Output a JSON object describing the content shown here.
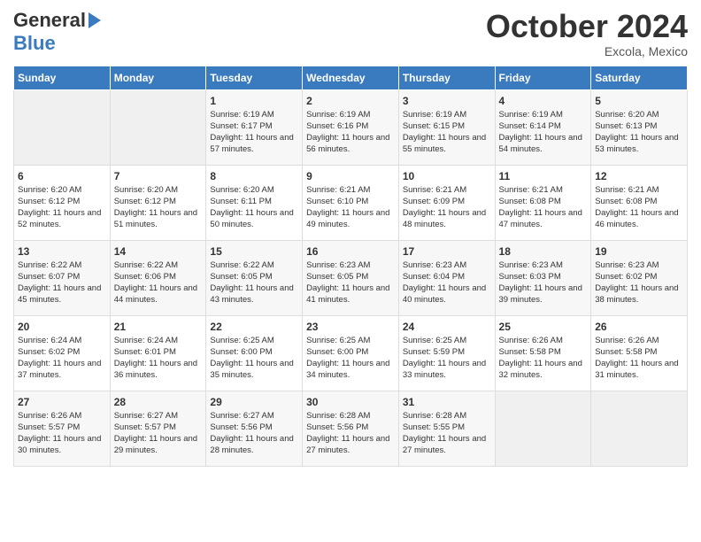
{
  "header": {
    "logo_line1": "General",
    "logo_line2": "Blue",
    "month": "October 2024",
    "location": "Excola, Mexico"
  },
  "weekdays": [
    "Sunday",
    "Monday",
    "Tuesday",
    "Wednesday",
    "Thursday",
    "Friday",
    "Saturday"
  ],
  "weeks": [
    [
      {
        "day": "",
        "info": ""
      },
      {
        "day": "",
        "info": ""
      },
      {
        "day": "1",
        "info": "Sunrise: 6:19 AM\nSunset: 6:17 PM\nDaylight: 11 hours and 57 minutes."
      },
      {
        "day": "2",
        "info": "Sunrise: 6:19 AM\nSunset: 6:16 PM\nDaylight: 11 hours and 56 minutes."
      },
      {
        "day": "3",
        "info": "Sunrise: 6:19 AM\nSunset: 6:15 PM\nDaylight: 11 hours and 55 minutes."
      },
      {
        "day": "4",
        "info": "Sunrise: 6:19 AM\nSunset: 6:14 PM\nDaylight: 11 hours and 54 minutes."
      },
      {
        "day": "5",
        "info": "Sunrise: 6:20 AM\nSunset: 6:13 PM\nDaylight: 11 hours and 53 minutes."
      }
    ],
    [
      {
        "day": "6",
        "info": "Sunrise: 6:20 AM\nSunset: 6:12 PM\nDaylight: 11 hours and 52 minutes."
      },
      {
        "day": "7",
        "info": "Sunrise: 6:20 AM\nSunset: 6:12 PM\nDaylight: 11 hours and 51 minutes."
      },
      {
        "day": "8",
        "info": "Sunrise: 6:20 AM\nSunset: 6:11 PM\nDaylight: 11 hours and 50 minutes."
      },
      {
        "day": "9",
        "info": "Sunrise: 6:21 AM\nSunset: 6:10 PM\nDaylight: 11 hours and 49 minutes."
      },
      {
        "day": "10",
        "info": "Sunrise: 6:21 AM\nSunset: 6:09 PM\nDaylight: 11 hours and 48 minutes."
      },
      {
        "day": "11",
        "info": "Sunrise: 6:21 AM\nSunset: 6:08 PM\nDaylight: 11 hours and 47 minutes."
      },
      {
        "day": "12",
        "info": "Sunrise: 6:21 AM\nSunset: 6:08 PM\nDaylight: 11 hours and 46 minutes."
      }
    ],
    [
      {
        "day": "13",
        "info": "Sunrise: 6:22 AM\nSunset: 6:07 PM\nDaylight: 11 hours and 45 minutes."
      },
      {
        "day": "14",
        "info": "Sunrise: 6:22 AM\nSunset: 6:06 PM\nDaylight: 11 hours and 44 minutes."
      },
      {
        "day": "15",
        "info": "Sunrise: 6:22 AM\nSunset: 6:05 PM\nDaylight: 11 hours and 43 minutes."
      },
      {
        "day": "16",
        "info": "Sunrise: 6:23 AM\nSunset: 6:05 PM\nDaylight: 11 hours and 41 minutes."
      },
      {
        "day": "17",
        "info": "Sunrise: 6:23 AM\nSunset: 6:04 PM\nDaylight: 11 hours and 40 minutes."
      },
      {
        "day": "18",
        "info": "Sunrise: 6:23 AM\nSunset: 6:03 PM\nDaylight: 11 hours and 39 minutes."
      },
      {
        "day": "19",
        "info": "Sunrise: 6:23 AM\nSunset: 6:02 PM\nDaylight: 11 hours and 38 minutes."
      }
    ],
    [
      {
        "day": "20",
        "info": "Sunrise: 6:24 AM\nSunset: 6:02 PM\nDaylight: 11 hours and 37 minutes."
      },
      {
        "day": "21",
        "info": "Sunrise: 6:24 AM\nSunset: 6:01 PM\nDaylight: 11 hours and 36 minutes."
      },
      {
        "day": "22",
        "info": "Sunrise: 6:25 AM\nSunset: 6:00 PM\nDaylight: 11 hours and 35 minutes."
      },
      {
        "day": "23",
        "info": "Sunrise: 6:25 AM\nSunset: 6:00 PM\nDaylight: 11 hours and 34 minutes."
      },
      {
        "day": "24",
        "info": "Sunrise: 6:25 AM\nSunset: 5:59 PM\nDaylight: 11 hours and 33 minutes."
      },
      {
        "day": "25",
        "info": "Sunrise: 6:26 AM\nSunset: 5:58 PM\nDaylight: 11 hours and 32 minutes."
      },
      {
        "day": "26",
        "info": "Sunrise: 6:26 AM\nSunset: 5:58 PM\nDaylight: 11 hours and 31 minutes."
      }
    ],
    [
      {
        "day": "27",
        "info": "Sunrise: 6:26 AM\nSunset: 5:57 PM\nDaylight: 11 hours and 30 minutes."
      },
      {
        "day": "28",
        "info": "Sunrise: 6:27 AM\nSunset: 5:57 PM\nDaylight: 11 hours and 29 minutes."
      },
      {
        "day": "29",
        "info": "Sunrise: 6:27 AM\nSunset: 5:56 PM\nDaylight: 11 hours and 28 minutes."
      },
      {
        "day": "30",
        "info": "Sunrise: 6:28 AM\nSunset: 5:56 PM\nDaylight: 11 hours and 27 minutes."
      },
      {
        "day": "31",
        "info": "Sunrise: 6:28 AM\nSunset: 5:55 PM\nDaylight: 11 hours and 27 minutes."
      },
      {
        "day": "",
        "info": ""
      },
      {
        "day": "",
        "info": ""
      }
    ]
  ]
}
